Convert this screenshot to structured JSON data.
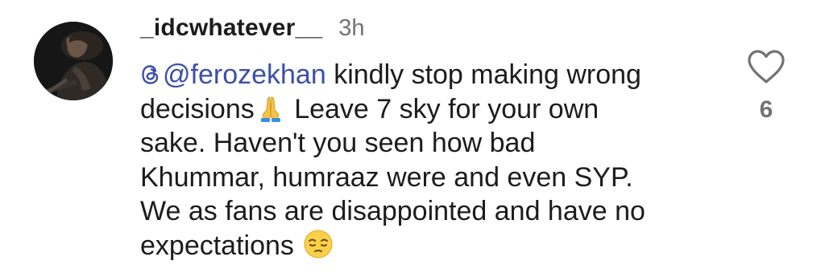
{
  "comment": {
    "username": "_idcwhatever__",
    "timestamp": "3h",
    "mention": "@ferozekhan",
    "text_part1": " kindly stop making wrong\ndecisions",
    "emoji1": "folded-hands",
    "text_part2": " Leave 7 sky for your own\nsake. Haven't you seen how bad\nKhummar, humraaz were and even SYP.\nWe as fans are disappointed and have no\nexpectations ",
    "emoji2": "pensive-face",
    "like_count": "6",
    "like_icon": "heart-outline-icon"
  },
  "colors": {
    "mention": "#3b4fa8",
    "timestamp": "#737373",
    "text": "#1c1c1c"
  }
}
